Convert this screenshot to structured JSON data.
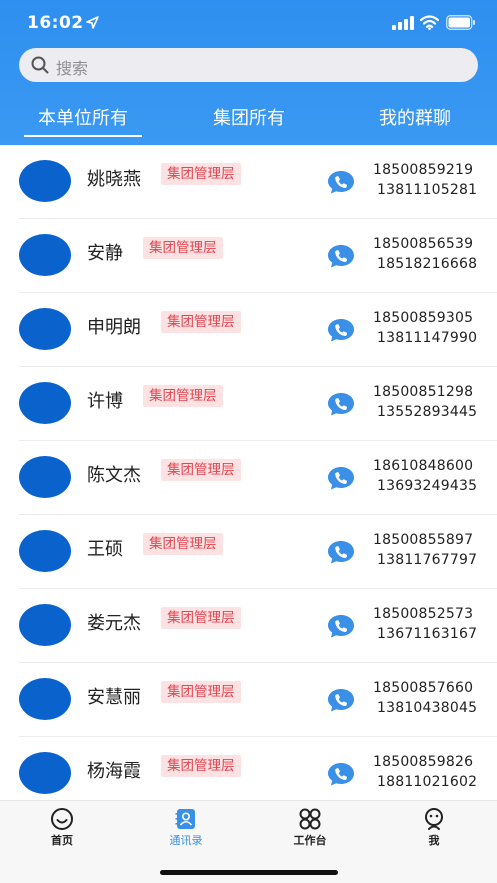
{
  "status_bar": {
    "time": "16:02"
  },
  "search": {
    "placeholder": "搜索"
  },
  "tabs": [
    {
      "label": "本单位所有",
      "active": true
    },
    {
      "label": "集团所有",
      "active": false
    },
    {
      "label": "我的群聊",
      "active": false
    }
  ],
  "contacts": [
    {
      "name": "姚晓燕",
      "badge": "集团管理层",
      "phone1": "18500859219",
      "phone2": "13811105281"
    },
    {
      "name": "安静",
      "badge": "集团管理层",
      "phone1": "18500856539",
      "phone2": "18518216668"
    },
    {
      "name": "申明朗",
      "badge": "集团管理层",
      "phone1": "18500859305",
      "phone2": "13811147990"
    },
    {
      "name": "许博",
      "badge": "集团管理层",
      "phone1": "18500851298",
      "phone2": "13552893445"
    },
    {
      "name": "陈文杰",
      "badge": "集团管理层",
      "phone1": "18610848600",
      "phone2": "13693249435"
    },
    {
      "name": "王硕",
      "badge": "集团管理层",
      "phone1": "18500855897",
      "phone2": "13811767797"
    },
    {
      "name": "娄元杰",
      "badge": "集团管理层",
      "phone1": "18500852573",
      "phone2": "13671163167"
    },
    {
      "name": "安慧丽",
      "badge": "集团管理层",
      "phone1": "18500857660",
      "phone2": "13810438045"
    },
    {
      "name": "杨海霞",
      "badge": "集团管理层",
      "phone1": "18500859826",
      "phone2": "18811021602"
    }
  ],
  "tabbar": [
    {
      "label": "首页",
      "icon": "smiley-icon",
      "active": false
    },
    {
      "label": "通讯录",
      "icon": "contacts-icon",
      "active": true
    },
    {
      "label": "工作台",
      "icon": "workbench-icon",
      "active": false
    },
    {
      "label": "我",
      "icon": "me-icon",
      "active": false
    }
  ],
  "colors": {
    "header": "#3a99f2",
    "avatar": "#0a62cd",
    "badge_bg": "#fde2e4",
    "badge_text": "#e3454f",
    "phone_icon": "#3a8fe6",
    "tab_active": "#3a8fe6"
  }
}
